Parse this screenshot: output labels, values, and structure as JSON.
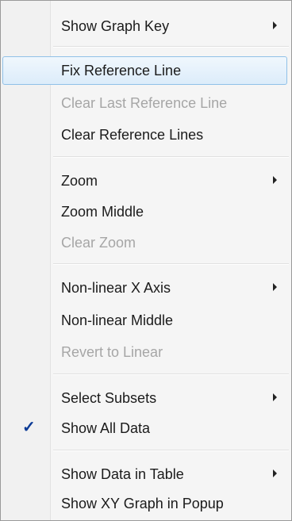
{
  "menu": {
    "items": [
      {
        "label": "Show Graph Key"
      },
      {
        "label": "Fix Reference Line"
      },
      {
        "label": "Clear Last Reference Line"
      },
      {
        "label": "Clear Reference Lines"
      },
      {
        "label": "Zoom"
      },
      {
        "label": "Zoom Middle"
      },
      {
        "label": "Clear Zoom"
      },
      {
        "label": "Non-linear X Axis"
      },
      {
        "label": "Non-linear Middle"
      },
      {
        "label": "Revert to Linear"
      },
      {
        "label": "Select Subsets"
      },
      {
        "label": "Show All Data"
      },
      {
        "label": "Show Data in Table"
      },
      {
        "label": "Show XY Graph in Popup"
      }
    ],
    "check_glyph": "✓"
  }
}
